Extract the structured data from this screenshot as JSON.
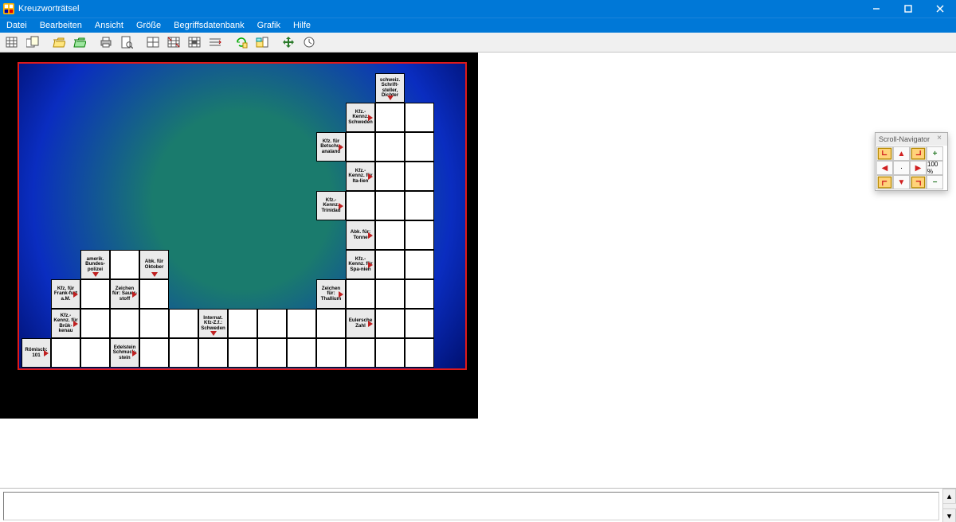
{
  "window": {
    "title": "Kreuzworträtsel"
  },
  "menu": {
    "items": [
      "Datei",
      "Bearbeiten",
      "Ansicht",
      "Größe",
      "Begriffsdatenbank",
      "Grafik",
      "Hilfe"
    ]
  },
  "toolbar": {
    "buttons": [
      "grid-new",
      "grid-with-sheet",
      "open",
      "save",
      "print",
      "print-preview",
      "grid-a",
      "grid-b",
      "grid-c",
      "grid-opts",
      "refresh-db",
      "view-db",
      "arrows-tool",
      "clock"
    ]
  },
  "clues": [
    {
      "row": 0,
      "col": 12,
      "text": "schweiz. Schrift-steller, Dichter",
      "arrow": "down"
    },
    {
      "row": 1,
      "col": 11,
      "text": "Kfz.-Kennz. Schweden",
      "arrow": "right"
    },
    {
      "row": 2,
      "col": 10,
      "text": "Kfz. für Betschu-analand",
      "arrow": "right"
    },
    {
      "row": 3,
      "col": 11,
      "text": "Kfz.-Kennz. für Ita-lien",
      "arrow": "right"
    },
    {
      "row": 4,
      "col": 10,
      "text": "Kfz.-Kennz. Trinidad",
      "arrow": "right"
    },
    {
      "row": 5,
      "col": 11,
      "text": "Abk. für: Tonne",
      "arrow": "right"
    },
    {
      "row": 6,
      "col": 2,
      "text": "amerik. Bundes-polizei",
      "arrow": "down"
    },
    {
      "row": 6,
      "col": 4,
      "text": "Abk. für Oktober",
      "arrow": "down"
    },
    {
      "row": 6,
      "col": 11,
      "text": "Kfz.-Kennz. für Spa-nien",
      "arrow": "right"
    },
    {
      "row": 7,
      "col": 1,
      "text": "Kfz. für Frank-furt a.M.",
      "arrow": "right"
    },
    {
      "row": 7,
      "col": 3,
      "text": "Zeichen für: Sauer-stoff",
      "arrow": "right"
    },
    {
      "row": 7,
      "col": 10,
      "text": "Zeichen für: Thallium",
      "arrow": "right"
    },
    {
      "row": 8,
      "col": 1,
      "text": "Kfz.-Kennz. für Brük-kenau",
      "arrow": "right"
    },
    {
      "row": 8,
      "col": 6,
      "text": "Internat. Kfz-Z.f.: Schweden",
      "arrow": "down"
    },
    {
      "row": 8,
      "col": 11,
      "text": "Eulersche Zahl",
      "arrow": "right"
    },
    {
      "row": 9,
      "col": 0,
      "text": "Römisch: 101",
      "arrow": "right"
    },
    {
      "row": 9,
      "col": 3,
      "text": "Edelstein Schmuck-stein",
      "arrow": "right"
    }
  ],
  "empty_cells": [
    [
      1,
      12
    ],
    [
      1,
      13
    ],
    [
      2,
      11
    ],
    [
      2,
      12
    ],
    [
      2,
      13
    ],
    [
      3,
      12
    ],
    [
      3,
      13
    ],
    [
      4,
      11
    ],
    [
      4,
      12
    ],
    [
      4,
      13
    ],
    [
      5,
      12
    ],
    [
      5,
      13
    ],
    [
      6,
      3
    ],
    [
      6,
      12
    ],
    [
      6,
      13
    ],
    [
      7,
      2
    ],
    [
      7,
      4
    ],
    [
      7,
      11
    ],
    [
      7,
      12
    ],
    [
      7,
      13
    ],
    [
      8,
      2
    ],
    [
      8,
      3
    ],
    [
      8,
      4
    ],
    [
      8,
      5
    ],
    [
      8,
      7
    ],
    [
      8,
      8
    ],
    [
      8,
      9
    ],
    [
      8,
      10
    ],
    [
      8,
      12
    ],
    [
      8,
      13
    ],
    [
      9,
      1
    ],
    [
      9,
      2
    ],
    [
      9,
      4
    ],
    [
      9,
      5
    ],
    [
      9,
      6
    ],
    [
      9,
      7
    ],
    [
      9,
      8
    ],
    [
      9,
      9
    ],
    [
      9,
      10
    ],
    [
      9,
      11
    ],
    [
      9,
      12
    ],
    [
      9,
      13
    ]
  ],
  "navigator": {
    "title": "Scroll-Navigator",
    "zoom": "100 %"
  }
}
